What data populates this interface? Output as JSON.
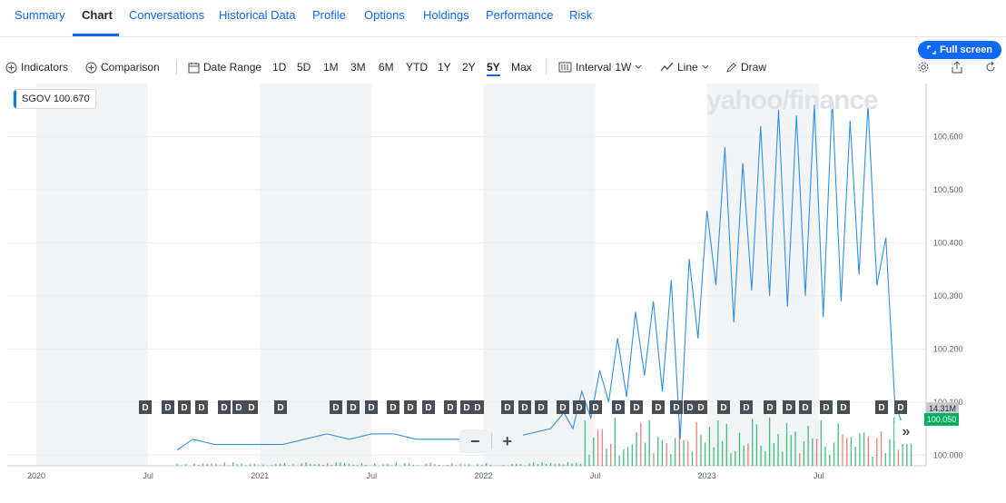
{
  "tabs": [
    {
      "label": "Summary"
    },
    {
      "label": "Chart"
    },
    {
      "label": "Conversations"
    },
    {
      "label": "Historical Data"
    },
    {
      "label": "Profile"
    },
    {
      "label": "Options"
    },
    {
      "label": "Holdings"
    },
    {
      "label": "Performance"
    },
    {
      "label": "Risk"
    }
  ],
  "active_tab": "Chart",
  "fullscreen_label": "Full screen",
  "toolbar": {
    "indicators": "Indicators",
    "comparison": "Comparison",
    "date_range": "Date Range",
    "ranges": [
      "1D",
      "5D",
      "1M",
      "3M",
      "6M",
      "YTD",
      "1Y",
      "2Y",
      "5Y",
      "Max"
    ],
    "active_range": "5Y",
    "interval_label": "Interval",
    "interval_value": "1W",
    "line_label": "Line",
    "draw_label": "Draw"
  },
  "legend": {
    "symbol": "SGOV",
    "value": "100.670"
  },
  "watermark": "yahoo/finance",
  "price_tag": "100.050",
  "volume_tag": "14.31M",
  "dividend_marker": "D",
  "colors": {
    "accent": "#0f69ff",
    "line": "#2f8fe3",
    "up": "#21b36b",
    "down": "#f06464",
    "price_tag": "#00b05e"
  },
  "chart_data": {
    "type": "line",
    "series": [
      {
        "name": "SGOV",
        "x": [
          2020.63,
          2020.7,
          2020.8,
          2020.9,
          2021.0,
          2021.1,
          2021.2,
          2021.3,
          2021.4,
          2021.5,
          2021.6,
          2021.7,
          2021.8,
          2021.9,
          2022.0,
          2022.1,
          2022.2,
          2022.3,
          2022.36,
          2022.4,
          2022.44,
          2022.48,
          2022.52,
          2022.56,
          2022.6,
          2022.64,
          2022.68,
          2022.72,
          2022.76,
          2022.8,
          2022.84,
          2022.88,
          2022.92,
          2022.96,
          2023.0,
          2023.04,
          2023.08,
          2023.12,
          2023.16,
          2023.2,
          2023.24,
          2023.28,
          2023.32,
          2023.36,
          2023.4,
          2023.44,
          2023.48,
          2023.52,
          2023.56,
          2023.6,
          2023.64,
          2023.68,
          2023.72,
          2023.76,
          2023.8,
          2023.84,
          2023.88,
          2023.92,
          2023.94
        ],
        "values": [
          100.01,
          100.03,
          100.02,
          100.02,
          100.02,
          100.02,
          100.03,
          100.04,
          100.03,
          100.04,
          100.04,
          100.03,
          100.03,
          100.03,
          100.03,
          100.03,
          100.04,
          100.05,
          100.08,
          100.05,
          100.12,
          100.07,
          100.16,
          100.1,
          100.22,
          100.11,
          100.27,
          100.15,
          100.29,
          100.12,
          100.33,
          100.03,
          100.37,
          100.22,
          100.46,
          100.32,
          100.58,
          100.25,
          100.55,
          100.31,
          100.62,
          100.3,
          100.65,
          100.28,
          100.64,
          100.3,
          100.66,
          100.26,
          100.67,
          100.29,
          100.63,
          100.34,
          100.66,
          100.32,
          100.41,
          100.1,
          100.05,
          100.05,
          100.05
        ]
      }
    ],
    "y_ticks": [
      "100.000",
      "100.100",
      "100.200",
      "100.300",
      "100.400",
      "100.500",
      "100.600"
    ],
    "ylim": [
      99.98,
      100.7
    ],
    "x_ticks": [
      "2020",
      "Jul",
      "2021",
      "Jul",
      "2022",
      "Jul",
      "2023",
      "Jul"
    ],
    "xlim": [
      2019.87,
      2023.98
    ],
    "grid": true
  }
}
